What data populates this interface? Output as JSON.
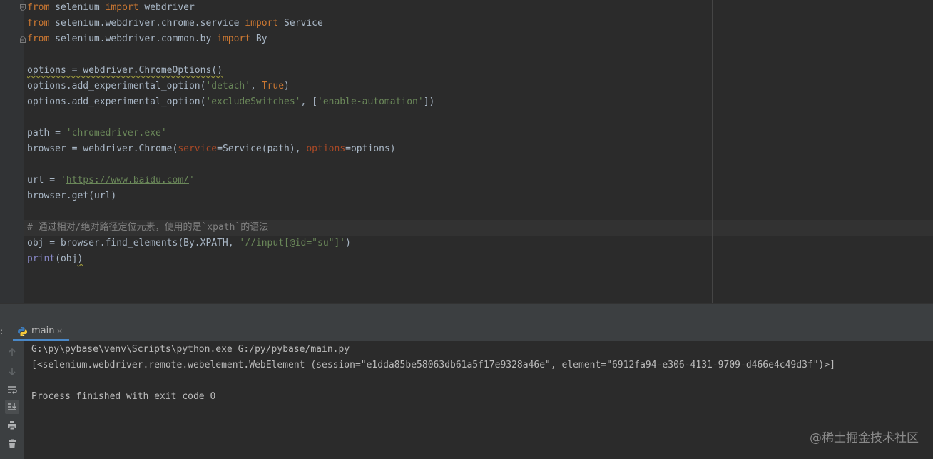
{
  "editor": {
    "lines": [
      [
        [
          "kw",
          "from"
        ],
        [
          "t",
          " selenium "
        ],
        [
          "kw",
          "import"
        ],
        [
          "t",
          " webdriver"
        ]
      ],
      [
        [
          "kw",
          "from"
        ],
        [
          "t",
          " selenium.webdriver.chrome.service "
        ],
        [
          "kw",
          "import"
        ],
        [
          "t",
          " Service"
        ]
      ],
      [
        [
          "kw",
          "from"
        ],
        [
          "t",
          " selenium.webdriver.common.by "
        ],
        [
          "kw",
          "import"
        ],
        [
          "t",
          " By"
        ]
      ],
      [],
      [
        [
          "sq",
          "options = webdriver.ChromeOptions()"
        ]
      ],
      [
        [
          "t",
          "options.add_experimental_option("
        ],
        [
          "str",
          "'detach'"
        ],
        [
          "t",
          ", "
        ],
        [
          "const",
          "True"
        ],
        [
          "t",
          ")"
        ]
      ],
      [
        [
          "t",
          "options.add_experimental_option("
        ],
        [
          "str",
          "'excludeSwitches'"
        ],
        [
          "t",
          ", ["
        ],
        [
          "str",
          "'enable-automation'"
        ],
        [
          "t",
          "])"
        ]
      ],
      [],
      [
        [
          "t",
          "path = "
        ],
        [
          "str",
          "'chromedriver.exe'"
        ]
      ],
      [
        [
          "t",
          "browser = webdriver.Chrome("
        ],
        [
          "param",
          "service"
        ],
        [
          "t",
          "=Service(path), "
        ],
        [
          "param",
          "options"
        ],
        [
          "t",
          "=options)"
        ]
      ],
      [],
      [
        [
          "t",
          "url = "
        ],
        [
          "str",
          "'"
        ],
        [
          "url",
          "https://www.baidu.com/"
        ],
        [
          "str",
          "'"
        ]
      ],
      [
        [
          "t",
          "browser.get(url)"
        ]
      ],
      [],
      [
        [
          "comment",
          "# 通过相对/绝对路径定位元素，使用的是`xpath`的语法"
        ]
      ],
      [
        [
          "t",
          "obj = browser.find_elements(By.XPATH, "
        ],
        [
          "str",
          "'//input[@id=\"su\"]'"
        ],
        [
          "t",
          ")"
        ]
      ],
      [
        [
          "builtin",
          "print"
        ],
        [
          "t",
          "(obj"
        ],
        [
          "sq",
          ")"
        ]
      ]
    ]
  },
  "run": {
    "header_colon": ":",
    "tab_label": "main",
    "tab_close": "×",
    "console": [
      "G:\\py\\pybase\\venv\\Scripts\\python.exe G:/py/pybase/main.py",
      "[<selenium.webdriver.remote.webelement.WebElement (session=\"e1dda85be58063db61a5f17e9328a46e\", element=\"6912fa94-e306-4131-9709-d466e4c49d3f\")>]",
      "",
      "Process finished with exit code 0"
    ],
    "toolbar_icons": [
      "arrow-up-icon",
      "arrow-down-icon",
      "soft-wrap-icon",
      "scroll-to-end-icon",
      "print-icon",
      "trash-icon"
    ]
  },
  "watermark": "@稀土掘金技术社区",
  "colors": {
    "keyword": "#cc7832",
    "string": "#6a8759",
    "param": "#aa4926",
    "comment": "#808080",
    "builtin": "#8888c6",
    "text": "#a9b7c6",
    "tab_underline": "#4a88c7"
  }
}
